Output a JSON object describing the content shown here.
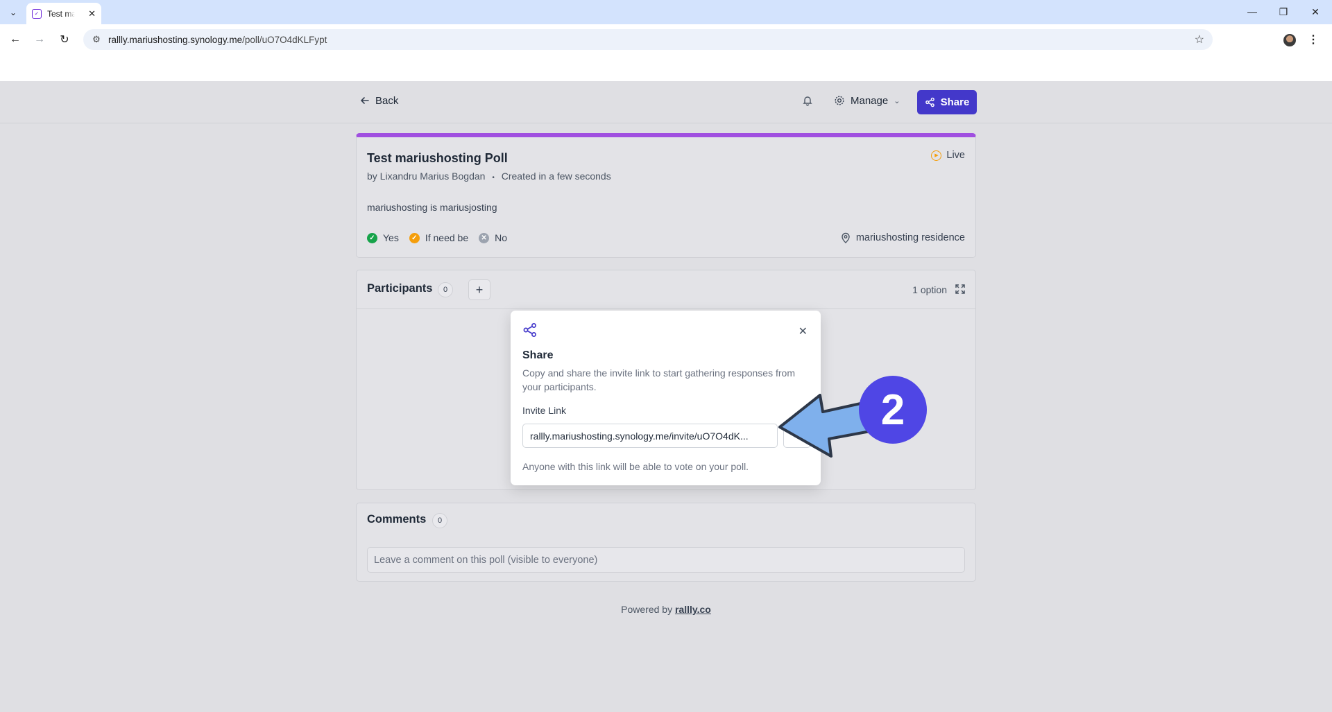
{
  "browser": {
    "tab_title": "Test mariushosting Poll",
    "url_host": "rallly.mariushosting.synology.me",
    "url_path": "/poll/uO7O4dKLFypt"
  },
  "header": {
    "back_label": "Back",
    "manage_label": "Manage",
    "share_label": "Share"
  },
  "poll": {
    "title": "Test mariushosting Poll",
    "author": "by Lixandru Marius Bogdan",
    "separator": "•",
    "created": "Created in a few seconds",
    "description": "mariushosting is mariusjosting",
    "status": "Live",
    "location": "mariushosting residence",
    "legend": [
      {
        "label": "Yes",
        "color": "#16a34a"
      },
      {
        "label": "If need be",
        "color": "#f59e0b"
      },
      {
        "label": "No",
        "color": "#9ca3af"
      }
    ]
  },
  "participants": {
    "title": "Participants",
    "count": "0",
    "options": "1 option"
  },
  "comments": {
    "title": "Comments",
    "count": "0",
    "placeholder": "Leave a comment on this poll (visible to everyone)"
  },
  "footer": {
    "prefix": "Powered by",
    "link": "rallly.co"
  },
  "dialog": {
    "title": "Share",
    "description": "Copy and share the invite link to start gathering responses from your participants.",
    "link_label": "Invite Link",
    "link_value": "rallly.mariushosting.synology.me/invite/uO7O4dK...",
    "hint": "Anyone with this link will be able to vote on your poll."
  },
  "annotation": {
    "step": "2",
    "color": "#4f46e5",
    "arrow_color": "#7fb0ec"
  }
}
